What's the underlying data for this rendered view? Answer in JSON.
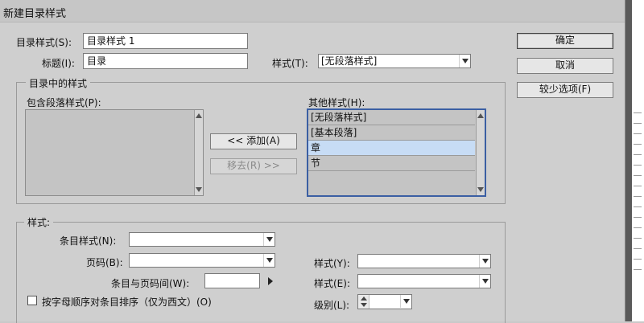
{
  "window": {
    "title": "新建目录样式"
  },
  "top": {
    "toc_style_label": "目录样式(S):",
    "toc_style_value": "目录样式 1",
    "heading_label": "标题(I):",
    "heading_value": "目录",
    "style_label": "样式(T):",
    "style_value": "[无段落样式]"
  },
  "buttons": {
    "ok": "确定",
    "cancel": "取消",
    "fewer_options": "较少选项(F)",
    "add": "<< 添加(A)",
    "remove": "移去(R) >>"
  },
  "styles_in_toc": {
    "group_label": "目录中的样式",
    "include_label": "包含段落样式(P):",
    "other_label": "其他样式(H):",
    "other_items": [
      "[无段落样式]",
      "[基本段落]",
      "章",
      "节"
    ],
    "selected_index": 2
  },
  "style_section": {
    "group_label": "样式:",
    "entry_style_label": "条目样式(N):",
    "entry_style_value": "",
    "page_number_label": "页码(B):",
    "page_number_value": "",
    "page_style_label": "样式(Y):",
    "page_style_value": "",
    "between_label": "条目与页码间(W):",
    "between_value": "",
    "between_style_label": "样式(E):",
    "between_style_value": "",
    "sort_label": "按字母顺序对条目排序（仅为西文）(O)",
    "level_label": "级别(L):",
    "level_value": ""
  },
  "colors": {
    "selection": "#c7dcf5",
    "list_border": "#3b5fa3"
  }
}
